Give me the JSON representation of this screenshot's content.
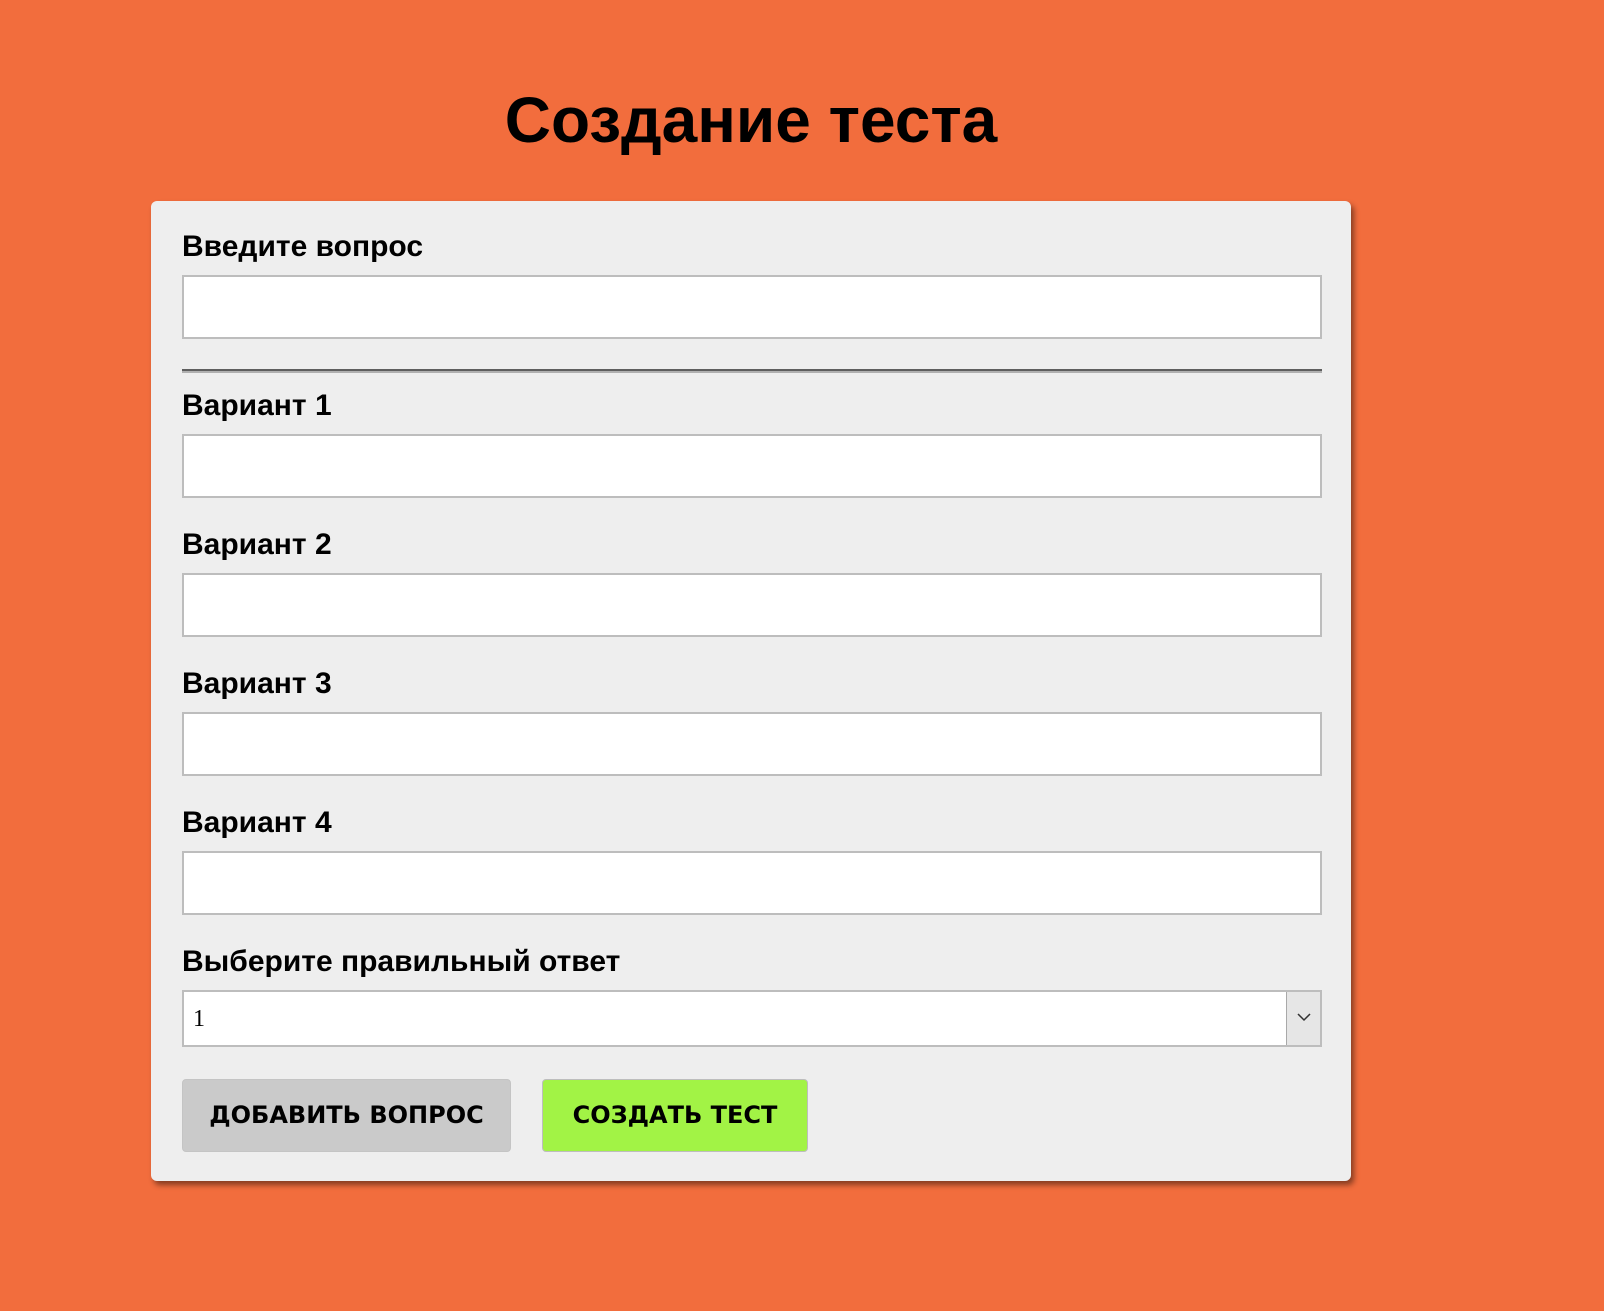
{
  "page": {
    "title": "Создание теста",
    "background_color": "#f26d3d"
  },
  "form": {
    "question": {
      "label": "Введите вопрос",
      "value": "",
      "placeholder": ""
    },
    "options": [
      {
        "label": "Вариант 1",
        "value": ""
      },
      {
        "label": "Вариант 2",
        "value": ""
      },
      {
        "label": "Вариант 3",
        "value": ""
      },
      {
        "label": "Вариант 4",
        "value": ""
      }
    ],
    "correct_answer": {
      "label": "Выберите правильный ответ",
      "selected": "1"
    },
    "buttons": {
      "add_question": "ДОБАВИТЬ ВОПРОС",
      "create_test": "СОЗДАТЬ ТЕСТ"
    }
  },
  "colors": {
    "card_background": "#eeeeee",
    "add_button": "#cacaca",
    "create_button": "#a2f345"
  }
}
